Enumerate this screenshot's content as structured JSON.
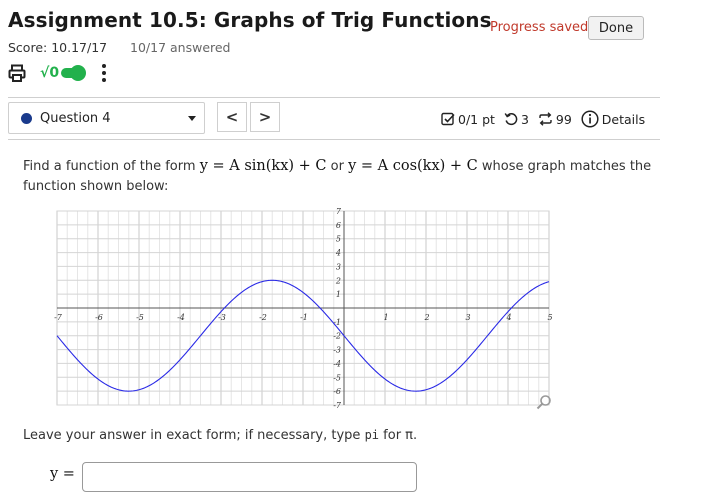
{
  "header": {
    "title": "Assignment 10.5: Graphs of Trig Functions",
    "progress_text": "Progress saved",
    "done_label": "Done",
    "score": "Score: 10.17/17",
    "answered": "10/17 answered"
  },
  "toolbar": {
    "sqrt_label": "√0"
  },
  "question_nav": {
    "selected": "Question 4",
    "prev": "<",
    "next": ">"
  },
  "meta": {
    "points": "0/1 pt",
    "attempts": "3",
    "submissions": "99",
    "details": "Details"
  },
  "prompt": {
    "pre": "Find a function of the form",
    "form1": "y = A sin(kx) + C",
    "or": "or",
    "form2": "y = A cos(kx) + C",
    "post": "whose graph matches the function shown below:"
  },
  "chart_data": {
    "type": "line",
    "xlim": [
      -7,
      5
    ],
    "ylim": [
      -7,
      7
    ],
    "x_ticks": [
      "-7",
      "-6",
      "-5",
      "-4",
      "-3",
      "-2",
      "-1",
      "1",
      "2",
      "3",
      "4",
      "5"
    ],
    "y_ticks": [
      "7",
      "6",
      "5",
      "4",
      "3",
      "2",
      "1",
      "-1",
      "-2",
      "-3",
      "-4",
      "-5",
      "-6",
      "-7"
    ],
    "grid": true,
    "series": [
      {
        "function": "-4*sin(pi*x/3.5)-2",
        "color": "#2a2ae6",
        "x_range": [
          -7,
          5
        ]
      }
    ]
  },
  "note": {
    "pre": "Leave your answer in exact form; if necessary, type",
    "code": "pi",
    "post": "for π."
  },
  "answer": {
    "label": "y =",
    "value": "",
    "placeholder": ""
  },
  "colors": {
    "accent": "#1a3a8c",
    "progress": "#c0392b",
    "curve": "#2a2ae6",
    "toggle": "#22b14c"
  }
}
